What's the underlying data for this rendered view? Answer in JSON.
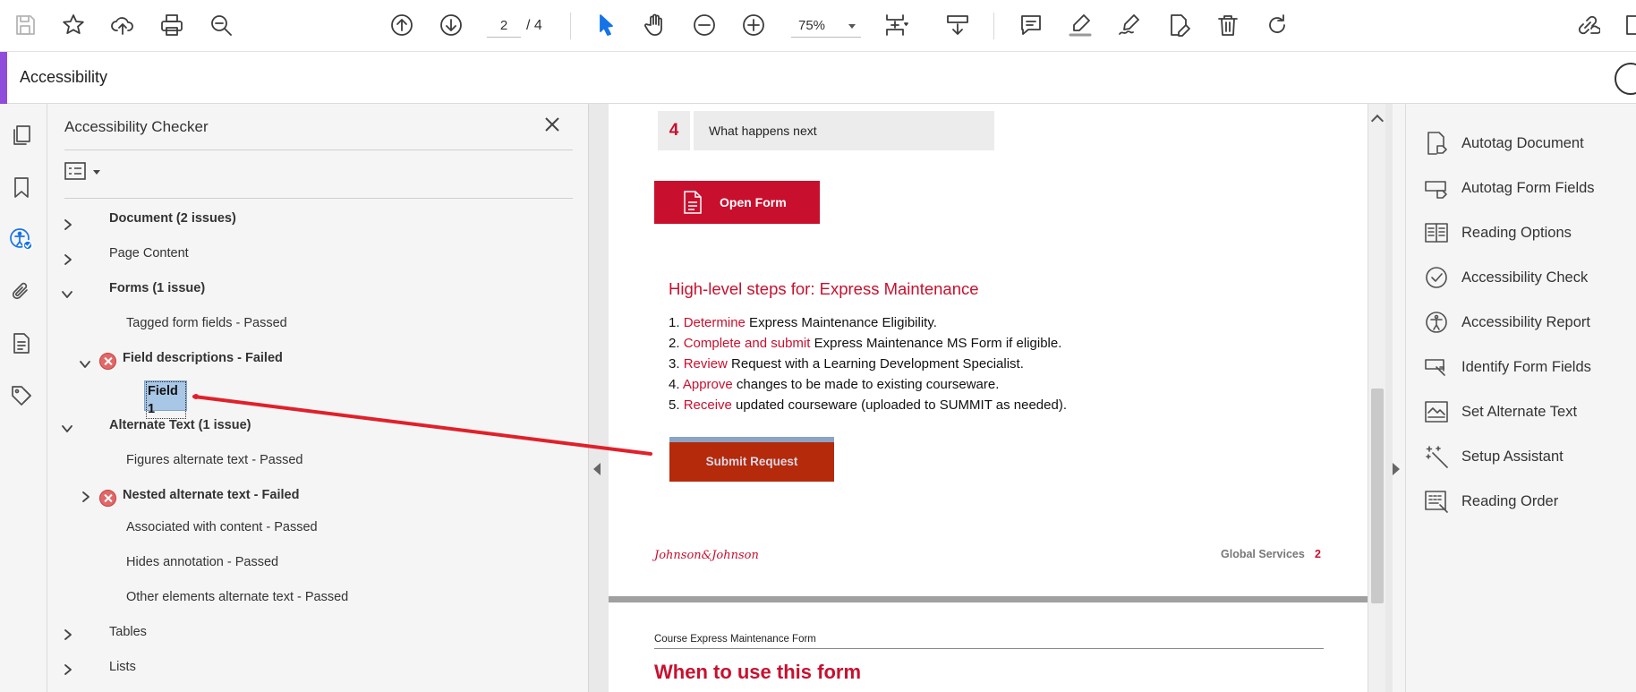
{
  "toolbar": {
    "page_current": "2",
    "page_of": "/  4",
    "zoom": "75%",
    "icons": [
      "save-icon",
      "star-icon",
      "cloud-upload-icon",
      "print-icon",
      "zoom-search-icon",
      "page-up-icon",
      "page-down-icon",
      "select-arrow-icon",
      "hand-icon",
      "zoom-out-icon",
      "zoom-in-icon",
      "fit-page-icon",
      "scroll-mode-icon",
      "comment-icon",
      "highlight-icon",
      "sign-icon",
      "edit-pdf-icon",
      "delete-icon",
      "rotate-icon",
      "share-link-icon"
    ]
  },
  "tool_title": "Accessibility",
  "panel": {
    "title": "Accessibility Checker",
    "tree": [
      {
        "label": "Document (2 issues)",
        "bold": true,
        "state": "collapsed"
      },
      {
        "label": "Page Content",
        "bold": false,
        "state": "collapsed"
      },
      {
        "label": "Forms (1 issue)",
        "bold": true,
        "state": "expanded"
      },
      {
        "label": "Tagged form fields - Passed",
        "bold": false
      },
      {
        "label": "Field descriptions - Failed",
        "bold": true,
        "state": "expanded",
        "failed": true
      },
      {
        "label": "Field 1",
        "bold": true,
        "selected": true
      },
      {
        "label": "Alternate Text (1 issue)",
        "bold": true,
        "state": "expanded"
      },
      {
        "label": "Figures alternate text - Passed",
        "bold": false
      },
      {
        "label": "Nested alternate text - Failed",
        "bold": true,
        "state": "collapsed",
        "failed": true
      },
      {
        "label": "Associated with content - Passed",
        "bold": false
      },
      {
        "label": "Hides annotation - Passed",
        "bold": false
      },
      {
        "label": "Other elements alternate text - Passed",
        "bold": false
      },
      {
        "label": "Tables",
        "bold": false,
        "state": "collapsed"
      },
      {
        "label": "Lists",
        "bold": false,
        "state": "collapsed"
      }
    ]
  },
  "document": {
    "step_number": "4",
    "step_text": "What happens next",
    "open_form_label": "Open Form",
    "steps_heading": "High-level steps for: Express Maintenance",
    "steps": [
      {
        "num": "1.",
        "kw": "Determine",
        "rest": " Express Maintenance Eligibility."
      },
      {
        "num": "2.",
        "kw": "Complete and submit",
        "rest": " Express Maintenance MS Form if eligible."
      },
      {
        "num": "3.",
        "kw": "Review",
        "rest": " Request with a Learning Development Specialist."
      },
      {
        "num": "4.",
        "kw": "Approve",
        "rest": " changes to be made to existing courseware."
      },
      {
        "num": "5.",
        "kw": "Receive",
        "rest": " updated courseware (uploaded to SUMMIT as needed)."
      }
    ],
    "submit_label": "Submit Request",
    "logo_text": "Johnson&Johnson",
    "footer_service": "Global Services",
    "footer_page": "2",
    "page2_header": "Course Express Maintenance Form",
    "page2_heading": "When to use this form"
  },
  "tools_pane": [
    {
      "label": "Autotag Document",
      "icon": "autotag-document-icon"
    },
    {
      "label": "Autotag Form Fields",
      "icon": "autotag-form-fields-icon"
    },
    {
      "label": "Reading Options",
      "icon": "reading-options-icon"
    },
    {
      "label": "Accessibility Check",
      "icon": "accessibility-check-icon"
    },
    {
      "label": "Accessibility Report",
      "icon": "accessibility-report-icon"
    },
    {
      "label": "Identify Form Fields",
      "icon": "identify-form-fields-icon"
    },
    {
      "label": "Set Alternate Text",
      "icon": "set-alternate-text-icon"
    },
    {
      "label": "Setup Assistant",
      "icon": "setup-assistant-icon"
    },
    {
      "label": "Reading Order",
      "icon": "reading-order-icon"
    }
  ],
  "colors": {
    "accent": "#8f4bd9",
    "brand_red": "#c8102e",
    "selection": "#a8c7e6",
    "annotation": "#e0202a"
  }
}
